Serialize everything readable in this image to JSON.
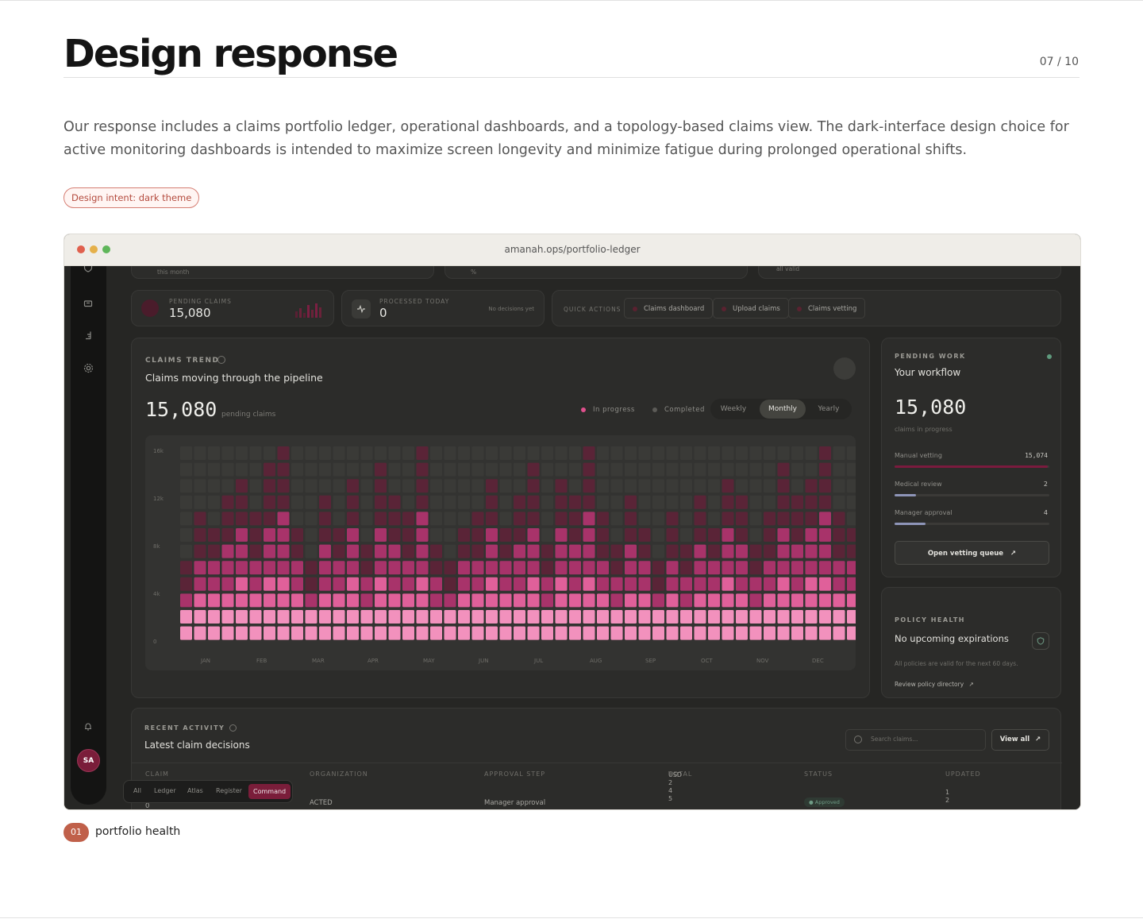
{
  "page": {
    "title": "Design response",
    "pager": "07 / 10",
    "lead": "Our response includes a claims portfolio ledger, operational dashboards, and a topology-based claims view. The dark-interface design choice for active monitoring dashboards is intended to maximize screen longevity and minimize fatigue during prolonged operational shifts.",
    "tag": "Design intent: dark theme",
    "figure_number": "01",
    "figure_caption": "portfolio health"
  },
  "browser": {
    "url": "amanah.ops/portfolio-ledger"
  },
  "app": {
    "top_partial": {
      "left_sub": "this month",
      "mid_sub": "%",
      "right_sub": "all valid"
    },
    "sidebar": {
      "avatar": "SA",
      "icons": [
        "shield-icon",
        "folder-icon",
        "chart-icon",
        "settings-icon",
        "bell-icon"
      ]
    },
    "stats": {
      "pending_label": "Pending claims",
      "pending_value": "15,080",
      "processed_label": "Processed today",
      "processed_value": "0",
      "processed_note": "No decisions yet",
      "quick_label": "Quick actions",
      "quick_actions": [
        "Claims dashboard",
        "Upload claims",
        "Claims vetting"
      ]
    },
    "trend": {
      "caption": "Claims trend",
      "subtitle": "Claims moving through the pipeline",
      "value": "15,080",
      "value_note": "pending claims",
      "legend": [
        "In progress",
        "Completed"
      ],
      "segments": [
        "Weekly",
        "Monthly",
        "Yearly"
      ],
      "active_segment": "Monthly",
      "y_ticks": [
        "16k",
        "12k",
        "8k",
        "4k",
        "0"
      ],
      "months": [
        "JAN",
        "FEB",
        "MAR",
        "APR",
        "MAY",
        "JUN",
        "JUL",
        "AUG",
        "SEP",
        "OCT",
        "NOV",
        "DEC"
      ]
    },
    "pending_work": {
      "caption": "Pending work",
      "title": "Your workflow",
      "value": "15,080",
      "note": "claims in progress",
      "rows": [
        {
          "label": "Manual vetting",
          "value": "15,074",
          "fill": 0.99,
          "color": "#7b1b3e"
        },
        {
          "label": "Medical review",
          "value": "2",
          "fill": 0.14,
          "color": "#8e95b8"
        },
        {
          "label": "Manager approval",
          "value": "4",
          "fill": 0.2,
          "color": "#8e95b8"
        }
      ],
      "button": "Open vetting queue"
    },
    "policy": {
      "caption": "Policy health",
      "title": "No upcoming expirations",
      "note": "All policies are valid for the next 60 days.",
      "link": "Review policy directory"
    },
    "activity": {
      "caption": "Recent activity",
      "title": "Latest claim decisions",
      "search_placeholder": "Search claims...",
      "view_all": "View all",
      "columns": [
        "Claim",
        "Organization",
        "Approval step",
        "Total",
        "Status",
        "Updated"
      ],
      "total_overlay": [
        "USD",
        "2",
        "4",
        "5"
      ],
      "row": {
        "claim": "0",
        "organization": "ACTED",
        "step": "Manager approval",
        "status": "Approved",
        "updated": [
          "1",
          "2"
        ]
      }
    },
    "command_bar": {
      "items": [
        "All",
        "Ledger",
        "Atlas",
        "Register",
        "Command"
      ],
      "active": "Command"
    }
  },
  "chart_data": {
    "type": "heatmap",
    "description_axis": "months JAN–DEC, 3 columns per month (weekly buckets)",
    "ylim": [
      0,
      16000
    ],
    "y_ticks": [
      "16k",
      "12k",
      "8k",
      "4k",
      "0"
    ],
    "categories": [
      "JAN",
      "FEB",
      "MAR",
      "APR",
      "MAY",
      "JUN",
      "JUL",
      "AUG",
      "SEP",
      "OCT",
      "NOV",
      "DEC"
    ],
    "columns_lit": [
      5,
      8,
      7,
      9,
      10,
      8,
      11,
      12,
      7,
      5,
      9,
      7,
      10,
      6,
      11,
      9,
      8,
      12,
      6,
      5,
      7,
      8,
      10,
      7,
      9,
      11,
      6,
      10,
      9,
      12,
      8,
      6,
      9,
      7,
      5,
      8,
      6,
      9,
      7,
      10,
      9,
      6,
      8,
      11,
      9,
      10,
      12,
      8,
      7,
      5
    ],
    "colors": {
      "empty": "#3a3a37",
      "low": "#5a2437",
      "mid": "#c9457e",
      "high": "#f7aacb"
    }
  }
}
